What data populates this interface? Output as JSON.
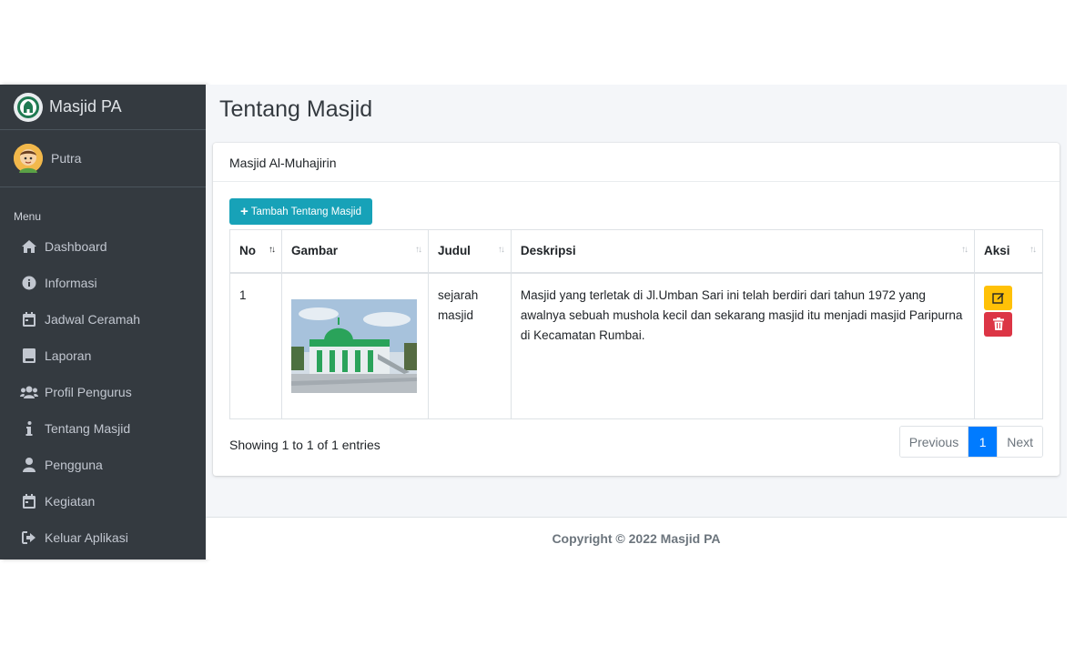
{
  "brand": {
    "name": "Masjid PA",
    "logo_icon": "mosque-logo-icon"
  },
  "user": {
    "name": "Putra",
    "avatar_icon": "user-avatar-icon"
  },
  "sidebar": {
    "header": "Menu",
    "items": [
      {
        "label": "Dashboard",
        "icon": "home-icon"
      },
      {
        "label": "Informasi",
        "icon": "info-circle-icon"
      },
      {
        "label": "Jadwal Ceramah",
        "icon": "calendar-icon"
      },
      {
        "label": "Laporan",
        "icon": "book-icon"
      },
      {
        "label": "Profil Pengurus",
        "icon": "users-icon"
      },
      {
        "label": "Tentang Masjid",
        "icon": "info-icon"
      },
      {
        "label": "Pengguna",
        "icon": "user-icon"
      },
      {
        "label": "Kegiatan",
        "icon": "calendar-icon"
      },
      {
        "label": "Keluar Aplikasi",
        "icon": "sign-out-icon"
      }
    ]
  },
  "page": {
    "title": "Tentang Masjid"
  },
  "card": {
    "title": "Masjid Al-Muhajirin",
    "add_button": "Tambah Tentang Masjid"
  },
  "table": {
    "columns": [
      "No",
      "Gambar",
      "Judul",
      "Deskripsi",
      "Aksi"
    ],
    "rows": [
      {
        "no": "1",
        "judul": "sejarah masjid",
        "deskripsi": "Masjid yang terletak di Jl.Umban Sari ini telah berdiri dari tahun 1972 yang awalnya sebuah mushola kecil dan sekarang masjid itu menjadi masjid Paripurna di Kecamatan Rumbai."
      }
    ]
  },
  "pagination": {
    "info": "Showing 1 to 1 of 1 entries",
    "previous": "Previous",
    "current": "1",
    "next": "Next"
  },
  "footer": {
    "text": "Copyright © 2022 Masjid PA"
  },
  "colors": {
    "sidebar": "#343a40",
    "primary": "#007bff",
    "info": "#17a2b8",
    "warning": "#ffc107",
    "danger": "#dc3545"
  }
}
